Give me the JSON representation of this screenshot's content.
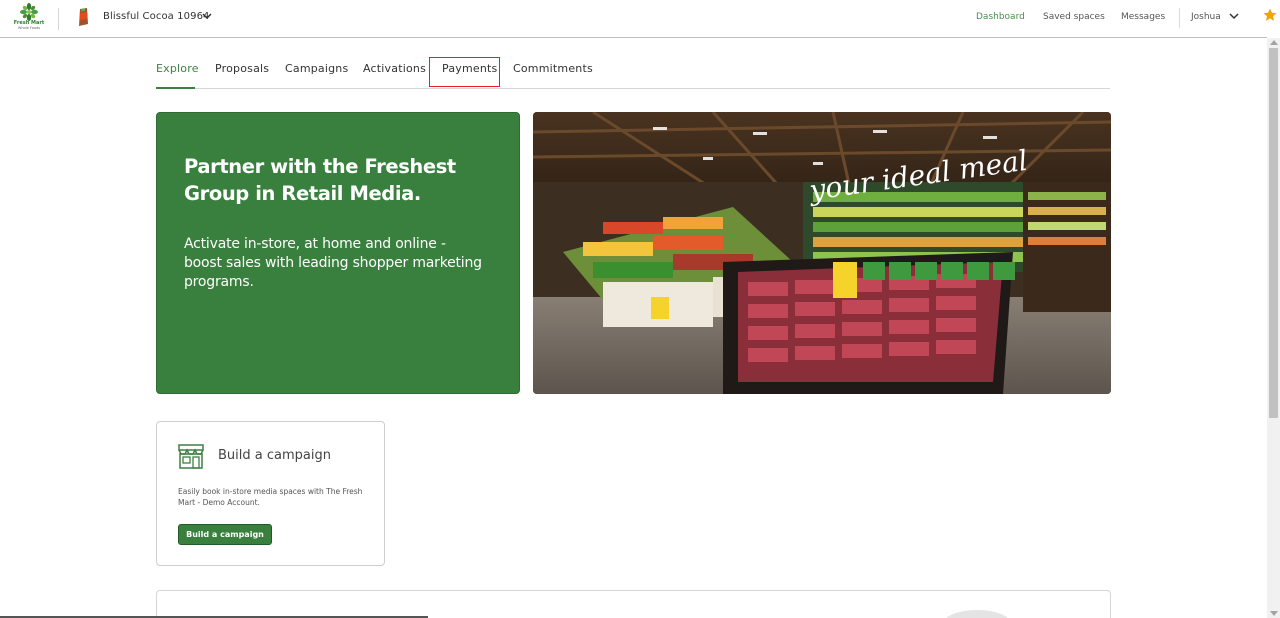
{
  "header": {
    "logo_text": "Fresh Mart",
    "logo_subtext": "Whole Foods",
    "brand_name": "Blissful Cocoa 10964",
    "nav": {
      "dashboard": "Dashboard",
      "saved_spaces": "Saved spaces",
      "messages": "Messages"
    },
    "user_name": "Joshua"
  },
  "tabs": {
    "explore": "Explore",
    "proposals": "Proposals",
    "campaigns": "Campaigns",
    "activations": "Activations",
    "payments": "Payments",
    "commitments": "Commitments"
  },
  "hero": {
    "title": "Partner with the Freshest Group in Retail Media.",
    "subtitle": "Activate in-store, at home and online - boost sales with leading shopper marketing programs.",
    "image_sign": "your ideal meal"
  },
  "build_campaign": {
    "title": "Build a campaign",
    "description": "Easily book in-store media spaces with The Fresh Mart - Demo Account.",
    "button_label": "Build a campaign"
  },
  "colors": {
    "brand_green": "#39803e",
    "active_tab": "#3e7f42",
    "highlight_box": "#e0202a",
    "star": "#f0a500"
  }
}
